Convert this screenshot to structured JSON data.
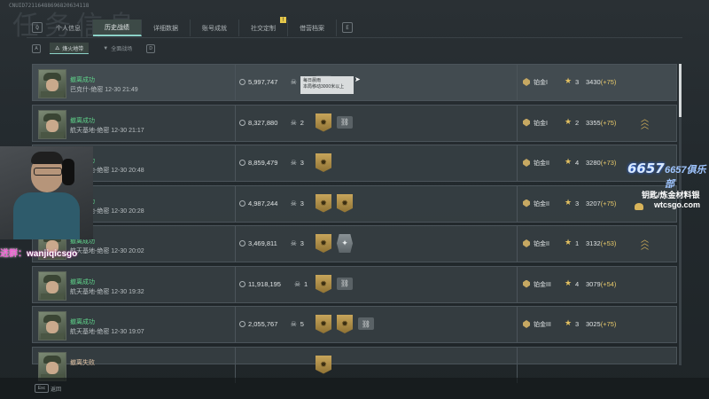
{
  "header": {
    "bg_title": "任务信息",
    "id_line": "CNUID72116488696820634118"
  },
  "key_hints": {
    "left": "Q",
    "right": "E",
    "sub_left": "A",
    "sub_right": "D",
    "esc": "Esc"
  },
  "tabs": [
    {
      "label": "个人信息",
      "active": false
    },
    {
      "label": "历史战绩",
      "active": true
    },
    {
      "label": "详细数据",
      "active": false
    },
    {
      "label": "账号成就",
      "active": false
    },
    {
      "label": "社交定制",
      "active": false
    },
    {
      "label": "借营档案",
      "active": false
    }
  ],
  "notification": "!",
  "subtabs": [
    {
      "label": "烽火地带",
      "active": true
    },
    {
      "label": "全面战场",
      "active": false
    }
  ],
  "matches": [
    {
      "result": "撤离成功",
      "location": "巴克什-绝密 12-30 21:49",
      "money": "5,997,747",
      "kills": "5",
      "badges": [
        "small"
      ],
      "rank": "铂金I",
      "stars": "3",
      "score": "3430",
      "delta": "(+75)",
      "chevrons": false,
      "fail": false
    },
    {
      "result": "撤离成功",
      "location": "航天基地-绝密 12-30 21:17",
      "money": "8,327,880",
      "kills": "2",
      "badges": [
        "gold",
        "small"
      ],
      "rank": "铂金I",
      "stars": "2",
      "score": "3355",
      "delta": "(+75)",
      "chevrons": true,
      "fail": false
    },
    {
      "result": "撤离成功",
      "location": "航天基地-绝密 12-30 20:48",
      "money": "8,859,479",
      "kills": "3",
      "badges": [
        "gold"
      ],
      "rank": "铂金II",
      "stars": "4",
      "score": "3280",
      "delta": "(+73)",
      "chevrons": false,
      "fail": false
    },
    {
      "result": "撤离成功",
      "location": "航天基地-绝密 12-30 20:28",
      "money": "4,987,244",
      "kills": "3",
      "badges": [
        "gold",
        "gold"
      ],
      "rank": "铂金II",
      "stars": "3",
      "score": "3207",
      "delta": "(+75)",
      "chevrons": false,
      "fail": false
    },
    {
      "result": "撤离成功",
      "location": "航天基地-绝密 12-30 20:02",
      "money": "3,469,811",
      "kills": "3",
      "badges": [
        "gold",
        "silver"
      ],
      "rank": "铂金II",
      "stars": "1",
      "score": "3132",
      "delta": "(+53)",
      "chevrons": true,
      "fail": false
    },
    {
      "result": "撤离成功",
      "location": "航天基地-绝密 12-30 19:32",
      "money": "11,918,195",
      "kills": "1",
      "badges": [
        "gold",
        "small"
      ],
      "rank": "铂金III",
      "stars": "4",
      "score": "3079",
      "delta": "(+54)",
      "chevrons": false,
      "fail": false
    },
    {
      "result": "撤离成功",
      "location": "航天基地-绝密 12-30 19:07",
      "money": "2,055,767",
      "kills": "5",
      "badges": [
        "gold",
        "gold",
        "small"
      ],
      "rank": "铂金III",
      "stars": "3",
      "score": "3025",
      "delta": "(+75)",
      "chevrons": false,
      "fail": false
    },
    {
      "result": "撤离失败",
      "location": "",
      "money": "",
      "kills": "",
      "badges": [
        "gold"
      ],
      "rank": "",
      "stars": "",
      "score": "",
      "delta": "",
      "chevrons": false,
      "fail": true
    }
  ],
  "tooltip": {
    "line1": "每日晨雨",
    "line2": "本局移动3000米以上"
  },
  "footer": {
    "back_label": "返回"
  },
  "overlay": {
    "group_label": "进群：",
    "group_value": "wanjiqicsgo",
    "logo_main": "6657",
    "logo_club": "6657俱乐部",
    "promo_line1": "钥匙/炼金材料银",
    "promo_line2": "wtcsgo.com"
  },
  "colors": {
    "success": "#5fd38a",
    "accent_tab": "#8bd2c8",
    "gold": "#c7a55b",
    "delta": "#e6c86a",
    "group_pink": "#f05fd2"
  }
}
